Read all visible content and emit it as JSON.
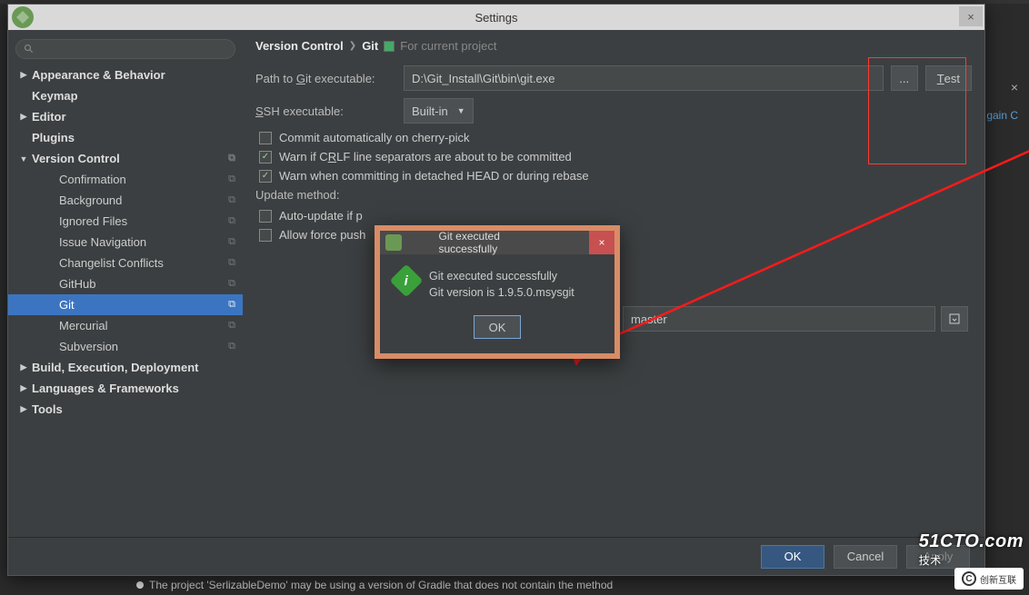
{
  "window": {
    "title": "Settings",
    "close": "×"
  },
  "search": {
    "placeholder": ""
  },
  "sidebar": [
    {
      "label": "Appearance & Behavior",
      "lvl": 0,
      "bold": true,
      "arrow": "▶"
    },
    {
      "label": "Keymap",
      "lvl": 0,
      "bold": true
    },
    {
      "label": "Editor",
      "lvl": 0,
      "bold": true,
      "arrow": "▶"
    },
    {
      "label": "Plugins",
      "lvl": 0,
      "bold": true
    },
    {
      "label": "Version Control",
      "lvl": 0,
      "bold": true,
      "arrow": "▼",
      "copy": true
    },
    {
      "label": "Confirmation",
      "lvl": "1b",
      "copy": true
    },
    {
      "label": "Background",
      "lvl": "1b",
      "copy": true
    },
    {
      "label": "Ignored Files",
      "lvl": "1b",
      "copy": true
    },
    {
      "label": "Issue Navigation",
      "lvl": "1b",
      "copy": true
    },
    {
      "label": "Changelist Conflicts",
      "lvl": "1b",
      "copy": true
    },
    {
      "label": "GitHub",
      "lvl": "1b",
      "copy": true
    },
    {
      "label": "Git",
      "lvl": "1b",
      "copy": true,
      "selected": true
    },
    {
      "label": "Mercurial",
      "lvl": "1b",
      "copy": true
    },
    {
      "label": "Subversion",
      "lvl": "1b",
      "copy": true
    },
    {
      "label": "Build, Execution, Deployment",
      "lvl": 0,
      "bold": true,
      "arrow": "▶"
    },
    {
      "label": "Languages & Frameworks",
      "lvl": 0,
      "bold": true,
      "arrow": "▶"
    },
    {
      "label": "Tools",
      "lvl": 0,
      "bold": true,
      "arrow": "▶"
    }
  ],
  "breadcrumb": {
    "root": "Version Control",
    "leaf": "Git",
    "for": "For current project"
  },
  "main": {
    "path_label_pre": "Path to ",
    "path_label_u": "G",
    "path_label_post": "it executable:",
    "path_value": "D:\\Git_Install\\Git\\bin\\git.exe",
    "browse": "...",
    "test_u": "T",
    "test_rest": "est",
    "ssh_label_u": "S",
    "ssh_label_post": "SH executable:",
    "ssh_value": "Built-in",
    "chk_cherry": "Commit automatically on cherry-pick",
    "chk_crlf_pre": "Warn if C",
    "chk_crlf_u": "R",
    "chk_crlf_post": "LF line separators are about to be committed",
    "chk_detached": "Warn when committing in detached HEAD or during rebase",
    "update_label": "Update method:",
    "chk_autoupdate": "Auto-update if p",
    "chk_force": "Allow force push",
    "branch_value": "master"
  },
  "popup": {
    "title": "Git executed successfully",
    "line1": "Git executed successfully",
    "line2": "Git version is 1.9.5.0.msysgit",
    "ok": "OK",
    "close": "×"
  },
  "footer": {
    "ok": "OK",
    "cancel": "Cancel",
    "apply": "Apply"
  },
  "bg": {
    "close": "×",
    "gain": "gain  C",
    "bottom": "The project 'SerlizableDemo' may be using a version of Gradle that does not contain the method"
  },
  "watermark": {
    "big": "51CTO.com",
    "small": "技术",
    "cx": "创新互联"
  }
}
